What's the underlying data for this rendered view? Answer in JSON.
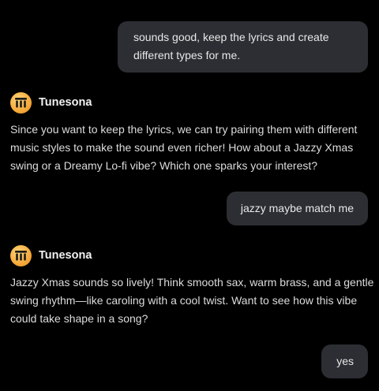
{
  "conversation": {
    "messages": [
      {
        "role": "user",
        "lines": [
          "sounds good, keep the lyrics and create",
          "different types for me."
        ]
      },
      {
        "role": "assistant",
        "name": "Tunesona",
        "avatar_icon": "tunesona-logo-icon",
        "lines": [
          "Since you want to keep the lyrics, we can try pairing them with different",
          "music styles to make the sound even richer! How about a Jazzy Xmas",
          "swing or a Dreamy Lo-fi vibe? Which one sparks your interest?"
        ]
      },
      {
        "role": "user",
        "lines": [
          "jazzy maybe match me"
        ]
      },
      {
        "role": "assistant",
        "name": "Tunesona",
        "avatar_icon": "tunesona-logo-icon",
        "lines": [
          "Jazzy Xmas sounds so lively! Think smooth sax, warm brass, and a gentle",
          "swing rhythm—like caroling with a cool twist. Want to see how this vibe",
          "could take shape in a song?"
        ]
      },
      {
        "role": "user",
        "lines": [
          "yes"
        ]
      }
    ]
  },
  "colors": {
    "background": "#000000",
    "user_bubble": "#2c2e33",
    "text": "#dcdcdc",
    "avatar_gradient": [
      "#ffd77a",
      "#e38c22"
    ]
  }
}
